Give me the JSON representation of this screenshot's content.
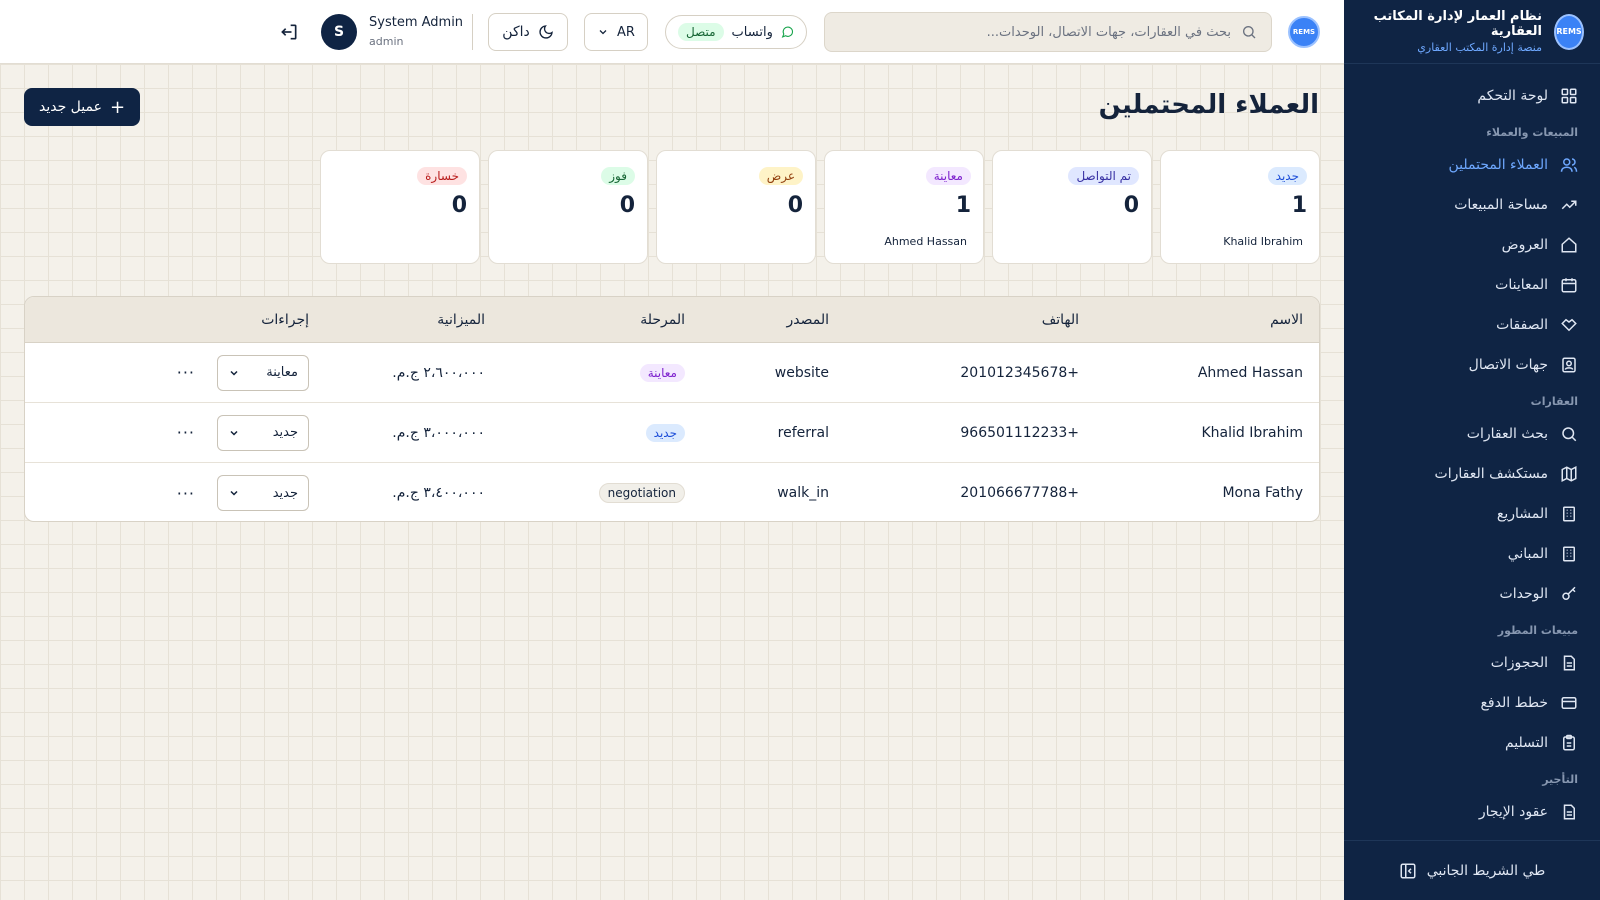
{
  "brand": {
    "title": "نظام العمار لإدارة المكاتب العقارية",
    "subtitle": "منصة إدارة المكتب العقاري",
    "logo_text": "REMS"
  },
  "sidebar": {
    "items": [
      {
        "label": "لوحة التحكم",
        "icon": "grid-icon"
      },
      {
        "section": "المبيعات والعملاء"
      },
      {
        "label": "العملاء المحتملين",
        "icon": "users-icon",
        "active": true
      },
      {
        "label": "مساحة المبيعات",
        "icon": "trend-icon"
      },
      {
        "label": "العروض",
        "icon": "home-icon"
      },
      {
        "label": "المعاينات",
        "icon": "calendar-icon"
      },
      {
        "label": "الصفقات",
        "icon": "handshake-icon"
      },
      {
        "label": "جهات الاتصال",
        "icon": "contact-icon"
      },
      {
        "section": "العقارات"
      },
      {
        "label": "بحث العقارات",
        "icon": "search-icon"
      },
      {
        "label": "مستكشف العقارات",
        "icon": "map-icon"
      },
      {
        "label": "المشاريع",
        "icon": "building-icon"
      },
      {
        "label": "المباني",
        "icon": "building-icon"
      },
      {
        "label": "الوحدات",
        "icon": "key-icon"
      },
      {
        "section": "مبيعات المطور"
      },
      {
        "label": "الحجوزات",
        "icon": "file-icon"
      },
      {
        "label": "خطط الدفع",
        "icon": "card-icon"
      },
      {
        "label": "التسليم",
        "icon": "clipboard-icon"
      },
      {
        "section": "التأجير"
      },
      {
        "label": "عقود الإيجار",
        "icon": "file-icon"
      }
    ],
    "collapse_label": "طي الشريط الجانبي"
  },
  "topbar": {
    "search_placeholder": "بحث في العقارات، جهات الاتصال، الوحدات...",
    "whatsapp_label": "واتساب",
    "whatsapp_status": "متصل",
    "language": "AR",
    "theme_label": "داكن",
    "user_name": "System Admin",
    "user_role": "admin",
    "user_initial": "S"
  },
  "page": {
    "title": "العملاء المحتملين",
    "new_button": "عميل جديد"
  },
  "stage_cards": [
    {
      "label": "جديد",
      "count": "1",
      "sub": "Khalid Ibrahim",
      "color_bg": "#dbeafe",
      "color_fg": "#1d4ed8"
    },
    {
      "label": "تم التواصل",
      "count": "0",
      "sub": "",
      "color_bg": "#e0e7ff",
      "color_fg": "#3730a3"
    },
    {
      "label": "معاينة",
      "count": "1",
      "sub": "Ahmed Hassan",
      "color_bg": "#f3e8ff",
      "color_fg": "#7e22ce"
    },
    {
      "label": "عرض",
      "count": "0",
      "sub": "",
      "color_bg": "#fef3c7",
      "color_fg": "#92400e"
    },
    {
      "label": "فوز",
      "count": "0",
      "sub": "",
      "color_bg": "#dcfce7",
      "color_fg": "#166534"
    },
    {
      "label": "خسارة",
      "count": "0",
      "sub": "",
      "color_bg": "#fee2e2",
      "color_fg": "#b91c1c"
    }
  ],
  "table": {
    "headers": {
      "name": "الاسم",
      "phone": "الهاتف",
      "source": "المصدر",
      "stage": "المرحلة",
      "budget": "الميزانية",
      "actions": "إجراءات"
    },
    "rows": [
      {
        "name": "Ahmed Hassan",
        "phone": "+201012345678",
        "source": "website",
        "stage": "معاينة",
        "stage_bg": "#f3e8ff",
        "stage_fg": "#7e22ce",
        "budget": "٢،٦٠٠،٠٠٠ ج.م.",
        "select": "معاينة"
      },
      {
        "name": "Khalid Ibrahim",
        "phone": "+966501112233",
        "source": "referral",
        "stage": "جديد",
        "stage_bg": "#dbeafe",
        "stage_fg": "#1d4ed8",
        "budget": "٣،٠٠٠،٠٠٠ ج.م.",
        "select": "جديد"
      },
      {
        "name": "Mona Fathy",
        "phone": "+201066677788",
        "source": "walk_in",
        "stage": "negotiation",
        "stage_bg": "#f1efe9",
        "stage_fg": "#14233b",
        "budget": "٣،٤٠٠،٠٠٠ ج.م.",
        "select": "جديد"
      }
    ]
  }
}
